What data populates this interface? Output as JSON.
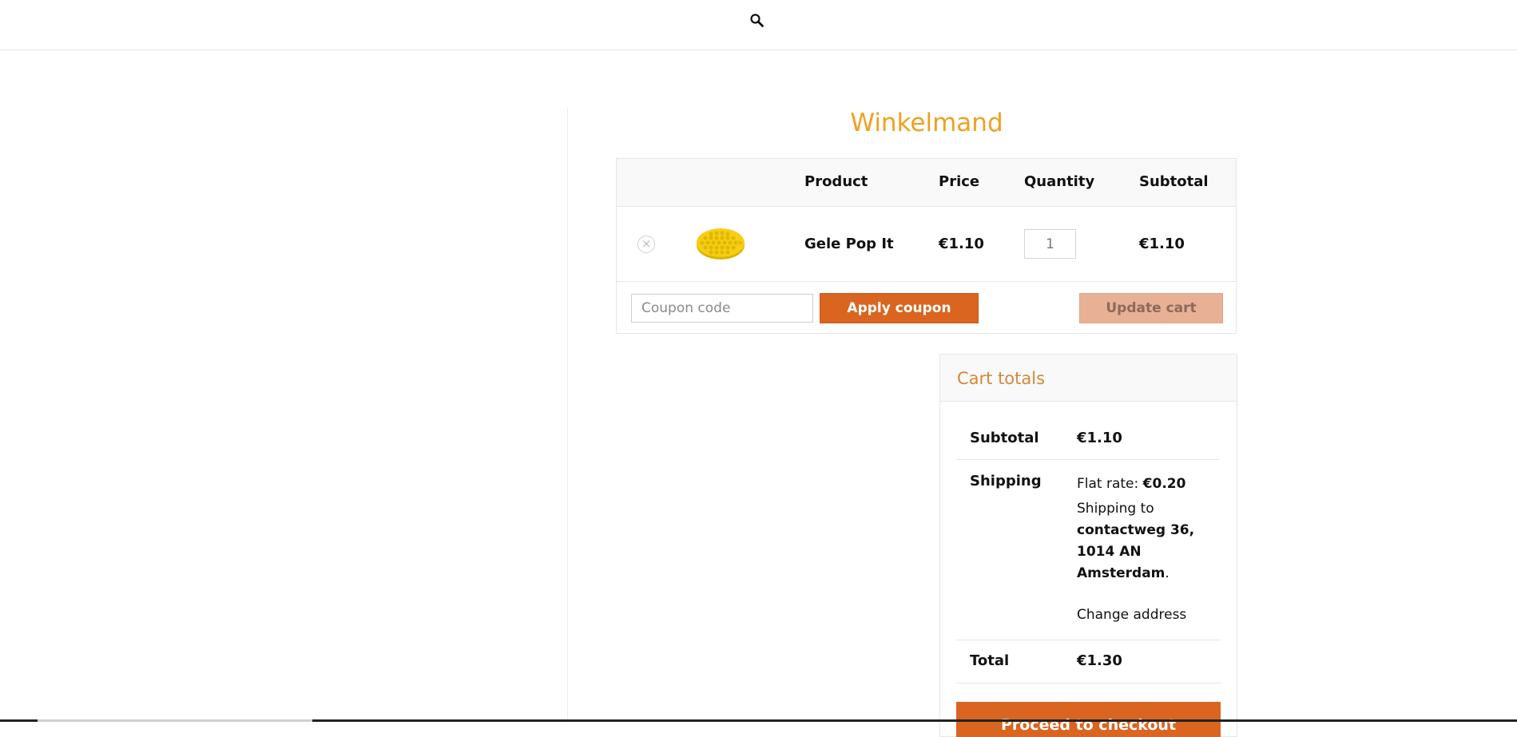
{
  "header": {
    "search_icon": "search-icon"
  },
  "page": {
    "title": "Winkelmand"
  },
  "cart_table": {
    "columns": [
      "",
      "",
      "Product",
      "Price",
      "Quantity",
      "Subtotal"
    ],
    "rows": [
      {
        "remove_icon": "close-circle-icon",
        "remove_symbol": "×",
        "product_name": "Gele Pop It",
        "price": "€1.10",
        "quantity": "1",
        "subtotal": "€1.10"
      }
    ],
    "coupon_placeholder": "Coupon code",
    "apply_coupon_label": "Apply coupon",
    "update_cart_label": "Update cart"
  },
  "cart_totals": {
    "title": "Cart totals",
    "subtotal_label": "Subtotal",
    "subtotal_value": "€1.10",
    "shipping_label": "Shipping",
    "shipping_method": "Flat rate: ",
    "shipping_price": "€0.20",
    "shipping_to_text": "Shipping to",
    "shipping_address_line1": "contactweg 36,",
    "shipping_address_line2": "1014 AN",
    "shipping_address_line3": "Amsterdam",
    "shipping_address_end": ".",
    "change_address_label": "Change address",
    "total_label": "Total",
    "total_value": "€1.30",
    "checkout_label": "Proceed to checkout"
  },
  "colors": {
    "accent_orange": "#d96521",
    "title_orange": "#f0a020",
    "totals_title": "#d5873a"
  }
}
